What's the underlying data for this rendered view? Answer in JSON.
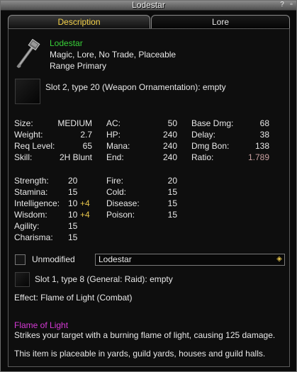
{
  "window": {
    "title": "Lodestar",
    "help_glyph": "?",
    "minimize_glyph": "▫"
  },
  "tabs": [
    {
      "label": "Description"
    },
    {
      "label": "Lore"
    }
  ],
  "item": {
    "name": "Lodestar",
    "flags": "Magic, Lore, No Trade, Placeable",
    "range": "Range Primary",
    "icon": "staff-weapon-icon"
  },
  "aug_slot": {
    "text": "Slot 2, type 20 (Weapon Ornamentation): empty",
    "icon": "empty-slot-icon"
  },
  "stats": {
    "col1": [
      {
        "label": "Size:",
        "value": "MEDIUM"
      },
      {
        "label": "Weight:",
        "value": "2.7"
      },
      {
        "label": "Req Level:",
        "value": "65"
      },
      {
        "label": "Skill:",
        "value": "2H Blunt"
      }
    ],
    "col2": [
      {
        "label": "AC:",
        "value": "50"
      },
      {
        "label": "HP:",
        "value": "240"
      },
      {
        "label": "Mana:",
        "value": "240"
      },
      {
        "label": "End:",
        "value": "240"
      }
    ],
    "col3": [
      {
        "label": "Base Dmg:",
        "value": "68"
      },
      {
        "label": "Delay:",
        "value": "38"
      },
      {
        "label": "Dmg Bon:",
        "value": "138"
      },
      {
        "label": "Ratio:",
        "value": "1.789"
      }
    ]
  },
  "attributes": [
    {
      "label": "Strength:",
      "value": "20",
      "bonus": ""
    },
    {
      "label": "Stamina:",
      "value": "15",
      "bonus": ""
    },
    {
      "label": "Intelligence:",
      "value": "10",
      "bonus": "+4"
    },
    {
      "label": "Wisdom:",
      "value": "10",
      "bonus": "+4"
    },
    {
      "label": "Agility:",
      "value": "15",
      "bonus": ""
    },
    {
      "label": "Charisma:",
      "value": "15",
      "bonus": ""
    }
  ],
  "resists": [
    {
      "label": "Fire:",
      "value": "20"
    },
    {
      "label": "Cold:",
      "value": "15"
    },
    {
      "label": "Disease:",
      "value": "15"
    },
    {
      "label": "Poison:",
      "value": "15"
    }
  ],
  "modifier": {
    "checkbox_label": "Unmodified",
    "checked": false,
    "dropdown_value": "Lodestar",
    "dropdown_icon": "diamond-arrow-icon"
  },
  "slot1": {
    "text": "Slot 1, type 8 (General: Raid): empty",
    "icon": "empty-slot-icon"
  },
  "effect": "Effect: Flame of Light (Combat)",
  "spell": {
    "name": "Flame of Light",
    "description": "Strikes your target with a burning flame of light, causing 125 damage."
  },
  "placeable_note": "This item is placeable in yards, guild yards, houses and guild halls.",
  "colors": {
    "item_name": "#38d038",
    "spell_name": "#d63ad6",
    "bonus": "#e6c44a",
    "ratio": "#c9a0a0",
    "active_tab": "#f6d34a"
  }
}
